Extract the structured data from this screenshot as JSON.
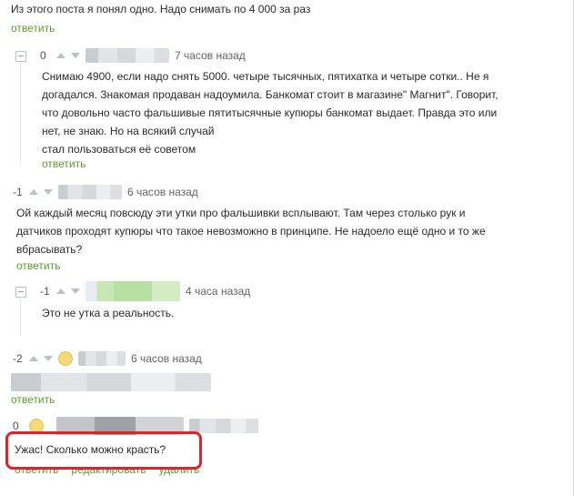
{
  "comments": [
    {
      "text": "Из этого поста я понял одно. Надо снимать по 4 000 за раз",
      "reply": "ответить"
    },
    {
      "score": "0",
      "time": "7 часов назад",
      "lines": [
        "Снимаю 4900, если надо снять 5000. четыре тысячных, пятихатка и четыре сотки.. Не я",
        "догадался. Знакомая продаван надоумила. Банкомат стоит в магазине\" Магнит\". Говорит,",
        "что  довольно часто фальшивые пятитысячные купюры банкомат выдает. Правда это или",
        "нет, не знаю. Но на всякий случай",
        "стал пользоваться её советом"
      ],
      "reply": "ответить"
    },
    {
      "score": "-1",
      "time": "6 часов назад",
      "lines": [
        "Ой каждый месяц повсюду эти утки про фальшивки всплывают. Там через столько рук и",
        "датчиков проходят купюры что такое невозможно в принципе. Не надоело ещё одно и то же",
        "вбрасывать?"
      ],
      "reply": "ответить"
    },
    {
      "score": "-1",
      "time": "4 часа назад",
      "text": "Это не утка а реальность."
    },
    {
      "score": "-2",
      "time": "6 часов назад",
      "reply": "ответить"
    },
    {
      "score": "0",
      "text": "Ужас! Сколько можно красть?",
      "actions": [
        "ответить",
        "редактировать",
        "удалить"
      ]
    }
  ],
  "colors": {
    "link": "#5aa02c",
    "highlight": "#e0232a"
  }
}
